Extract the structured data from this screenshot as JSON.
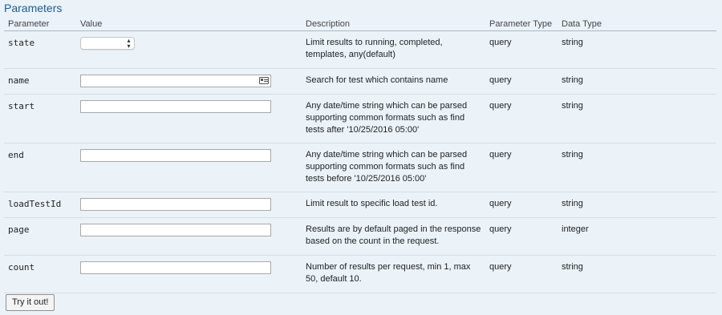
{
  "section_title": "Parameters",
  "columns": {
    "parameter": "Parameter",
    "value": "Value",
    "description": "Description",
    "parameter_type": "Parameter Type",
    "data_type": "Data Type"
  },
  "rows": [
    {
      "name": "state",
      "input_kind": "select",
      "selected_value": "",
      "description": "Limit results to running, completed, templates, any(default)",
      "param_type": "query",
      "data_type": "string"
    },
    {
      "name": "name",
      "input_kind": "text-with-card-icon",
      "value": "",
      "description": "Search for test which contains name",
      "param_type": "query",
      "data_type": "string"
    },
    {
      "name": "start",
      "input_kind": "text",
      "value": "",
      "description": "Any date/time string which can be parsed supporting common formats such as find tests after '10/25/2016 05:00'",
      "param_type": "query",
      "data_type": "string"
    },
    {
      "name": "end",
      "input_kind": "text",
      "value": "",
      "description": "Any date/time string which can be parsed supporting common formats such as find tests before '10/25/2016 05:00'",
      "param_type": "query",
      "data_type": "string"
    },
    {
      "name": "loadTestId",
      "input_kind": "text",
      "value": "",
      "description": "Limit result to specific load test id.",
      "param_type": "query",
      "data_type": "string"
    },
    {
      "name": "page",
      "input_kind": "text",
      "value": "",
      "description": "Results are by default paged in the response based on the count in the request.",
      "param_type": "query",
      "data_type": "integer"
    },
    {
      "name": "count",
      "input_kind": "text",
      "value": "",
      "description": "Number of results per request, min 1, max 50, default 10.",
      "param_type": "query",
      "data_type": "string"
    }
  ],
  "try_button_label": "Try it out!",
  "icons": {
    "select": "chevron-up-down-icon",
    "name_field": "contact-card-icon"
  },
  "colors": {
    "background": "#ebf3f9",
    "title": "#1b5c9c"
  }
}
